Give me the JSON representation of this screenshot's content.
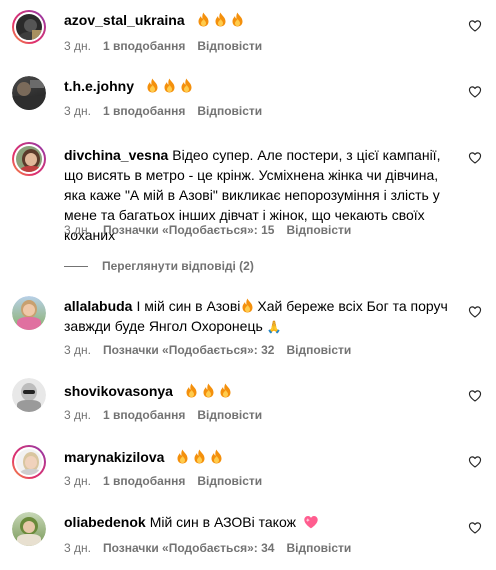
{
  "comments": [
    {
      "user": "azov_stal_ukraina",
      "text": "",
      "fire_count": 3,
      "time": "3 дн.",
      "likes": "1 вподобання",
      "reply": "Відповісти",
      "avatar": "dark-profile-ring"
    },
    {
      "user": "t.h.e.johny",
      "text": "",
      "fire_count": 3,
      "time": "3 дн.",
      "likes": "1 вподобання",
      "reply": "Відповісти",
      "avatar": "dark-outdoor"
    },
    {
      "user": "divchina_vesna",
      "text": "Відео супер. Але постери, з цієї кампанії, що висять в метро - це крінж. Усміхнена жінка чи дівчина, яка каже \"А мій в Азові\" викликає непорозуміння і злість у мене та багатьох інших дівчат і жінок, що чекають своїх коханих",
      "time": "3 дн.",
      "likes": "Позначки «Подобається»: 15",
      "reply": "Відповісти",
      "avatar": "woman-ring"
    },
    {
      "user": "allalabuda",
      "text_before": "І мій син в Азові",
      "text_after": "Хай береже всіх Бог та поруч завжди буде Янгол Охоронець",
      "emoji_end": "🙏",
      "time": "3 дн.",
      "likes": "Позначки «Подобається»: 32",
      "reply": "Відповісти",
      "avatar": "woman-outdoor"
    },
    {
      "user": "shovikovasonya",
      "text": "",
      "fire_count": 3,
      "time": "3 дн.",
      "likes": "1 вподобання",
      "reply": "Відповісти",
      "avatar": "woman-bw"
    },
    {
      "user": "marynakizilova",
      "text": "",
      "fire_count": 3,
      "time": "3 дн.",
      "likes": "1 вподобання",
      "reply": "Відповісти",
      "avatar": "woman-ring-light"
    },
    {
      "user": "oliabedenok",
      "text": "Мій син в АЗОВі також",
      "emoji_end": "💖",
      "time": "3 дн.",
      "likes": "Позначки «Подобається»: 34",
      "reply": "Відповісти",
      "avatar": "woman-green"
    }
  ],
  "view_replies": "Переглянути відповіді (2)",
  "colors": {
    "meta_text": "#737373",
    "fire_outer": "#f4900c",
    "fire_inner": "#ffcc4d",
    "heart_pink": "#ff5d8f"
  }
}
